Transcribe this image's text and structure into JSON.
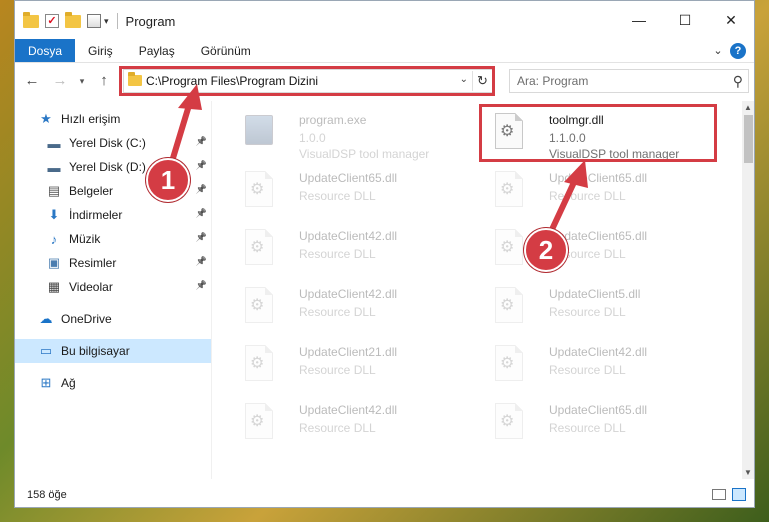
{
  "window": {
    "title": "Program",
    "controls": {
      "minimize": "—",
      "maximize": "☐",
      "close": "✕"
    }
  },
  "ribbon": {
    "tabs": [
      {
        "label": "Dosya",
        "active": true
      },
      {
        "label": "Giriş"
      },
      {
        "label": "Paylaş"
      },
      {
        "label": "Görünüm"
      }
    ],
    "help": "?"
  },
  "address": {
    "path": "C:\\Program Files\\Program Dizini",
    "search_placeholder": "Ara: Program"
  },
  "navpane": {
    "items": [
      {
        "label": "Hızlı erişim",
        "icon": "star-icon",
        "glyph": "★",
        "color": "#2b78c5",
        "pinned": false
      },
      {
        "label": "Yerel Disk (C:)",
        "icon": "drive-c-icon",
        "glyph": "▬",
        "color": "#4a6a8a",
        "pinned": true
      },
      {
        "label": "Yerel Disk (D:)",
        "icon": "drive-d-icon",
        "glyph": "▬",
        "color": "#4a6a8a",
        "pinned": true
      },
      {
        "label": "Belgeler",
        "icon": "documents-icon",
        "glyph": "▤",
        "color": "#555555",
        "pinned": true
      },
      {
        "label": "İndirmeler",
        "icon": "downloads-icon",
        "glyph": "⬇",
        "color": "#2b78c5",
        "pinned": true
      },
      {
        "label": "Müzik",
        "icon": "music-icon",
        "glyph": "♪",
        "color": "#2b78c5",
        "pinned": true
      },
      {
        "label": "Resimler",
        "icon": "pictures-icon",
        "glyph": "▣",
        "color": "#4a7db0",
        "pinned": true
      },
      {
        "label": "Videolar",
        "icon": "videos-icon",
        "glyph": "▦",
        "color": "#444444",
        "pinned": true
      },
      {
        "label": "OneDrive",
        "icon": "onedrive-icon",
        "glyph": "☁",
        "color": "#1a73c8",
        "pinned": false
      },
      {
        "label": "Bu bilgisayar",
        "icon": "computer-icon",
        "glyph": "▭",
        "color": "#2b78c5",
        "pinned": false,
        "selected": true
      },
      {
        "label": "Ağ",
        "icon": "network-icon",
        "glyph": "⊞",
        "color": "#2b78c5",
        "pinned": false
      }
    ]
  },
  "files": {
    "left": [
      {
        "name": "program.exe",
        "line2": "1.0.0",
        "line3": "VisualDSP tool manager",
        "icon": "exe-icon"
      },
      {
        "name": "UpdateClient65.dll",
        "line2": "Resource DLL"
      },
      {
        "name": "UpdateClient42.dll",
        "line2": "Resource DLL"
      },
      {
        "name": "UpdateClient42.dll",
        "line2": "Resource DLL"
      },
      {
        "name": "UpdateClient21.dll",
        "line2": "Resource DLL"
      },
      {
        "name": "UpdateClient42.dll",
        "line2": "Resource DLL"
      }
    ],
    "right": [
      {
        "name": "toolmgr.dll",
        "line2": "1.1.0.0",
        "line3": "VisualDSP tool manager",
        "highlight": true
      },
      {
        "name": "UpdateClient65.dll",
        "line2": "Resource DLL"
      },
      {
        "name": "UpdateClient65.dll",
        "line2": "Resource DLL"
      },
      {
        "name": "UpdateClient5.dll",
        "line2": "Resource DLL"
      },
      {
        "name": "UpdateClient42.dll",
        "line2": "Resource DLL"
      },
      {
        "name": "UpdateClient65.dll",
        "line2": "Resource DLL"
      }
    ]
  },
  "status": {
    "count": "158 öğe"
  },
  "annotations": {
    "step1": "1",
    "step2": "2",
    "color": "#d43c44"
  }
}
